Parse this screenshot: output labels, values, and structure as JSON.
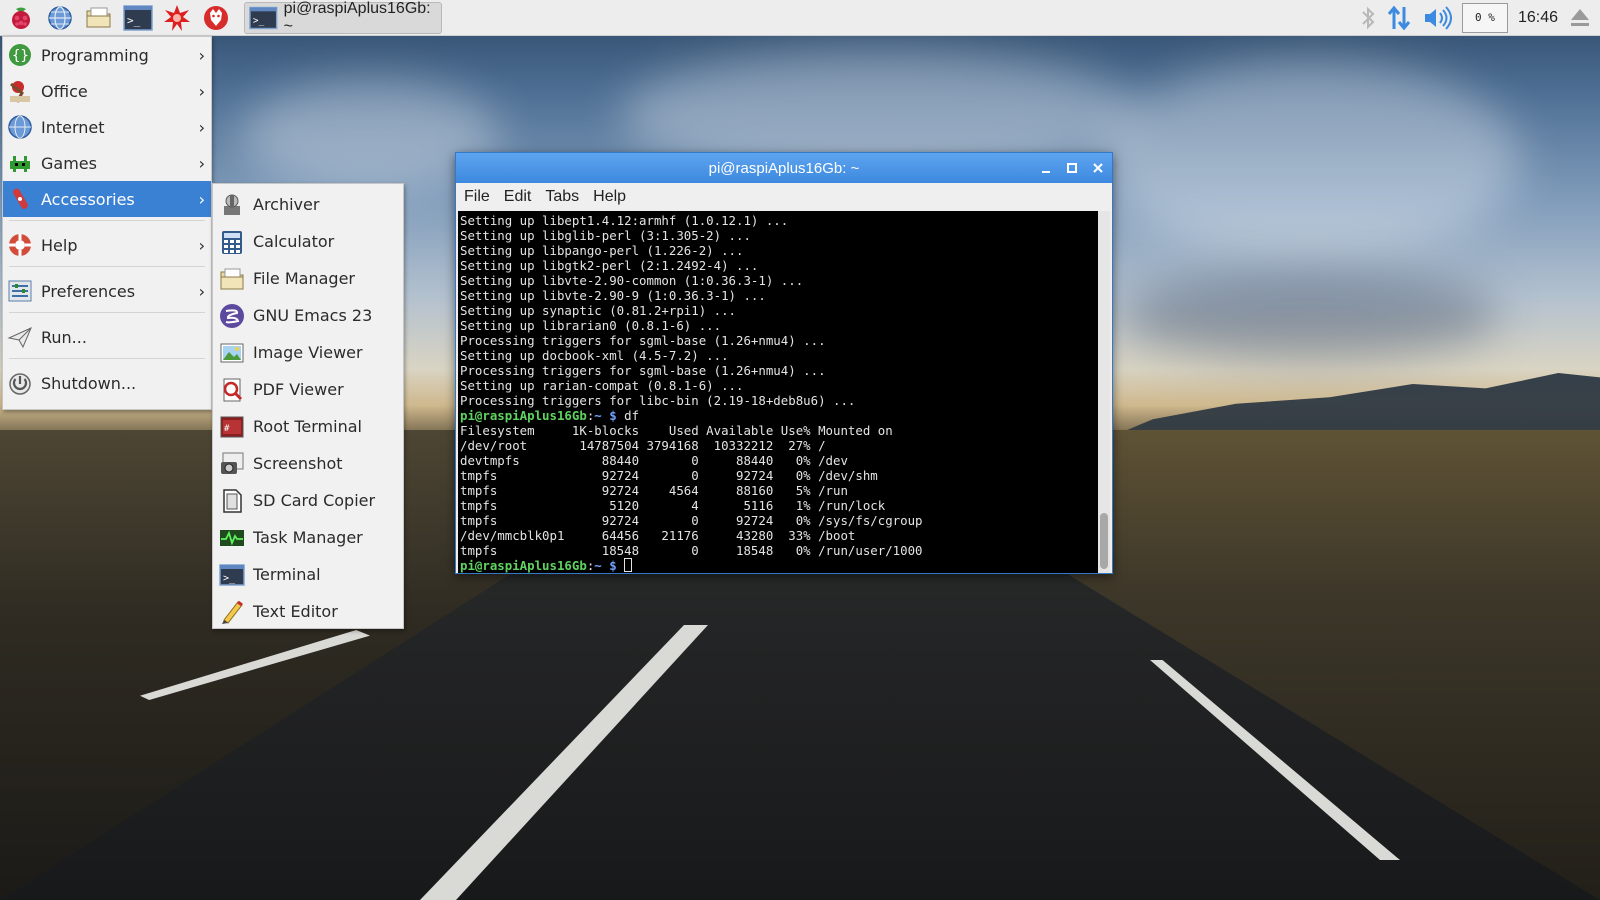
{
  "taskbar": {
    "launchers": [
      {
        "name": "raspberry-menu-icon"
      },
      {
        "name": "globe-browser-icon"
      },
      {
        "name": "file-manager-icon"
      },
      {
        "name": "terminal-icon"
      },
      {
        "name": "mathematica-icon"
      },
      {
        "name": "wolfram-icon"
      }
    ],
    "task_title": "pi@raspiAplus16Gb: ~",
    "cpu_label": "0 %",
    "clock": "16:46"
  },
  "menu": {
    "items": [
      {
        "label": "Programming",
        "icon": "programming-icon",
        "has_sub": true
      },
      {
        "label": "Office",
        "icon": "office-icon",
        "has_sub": true
      },
      {
        "label": "Internet",
        "icon": "internet-icon",
        "has_sub": true
      },
      {
        "label": "Games",
        "icon": "games-icon",
        "has_sub": true
      },
      {
        "label": "Accessories",
        "icon": "accessories-icon",
        "has_sub": true,
        "active": true
      },
      {
        "label": "Help",
        "icon": "help-icon",
        "has_sub": true
      },
      {
        "label": "Preferences",
        "icon": "preferences-icon",
        "has_sub": true
      },
      {
        "label": "Run...",
        "icon": "run-icon",
        "has_sub": false
      },
      {
        "label": "Shutdown...",
        "icon": "shutdown-icon",
        "has_sub": false
      }
    ],
    "arrow": "›"
  },
  "submenu": {
    "items": [
      {
        "label": "Archiver",
        "icon": "archiver-icon"
      },
      {
        "label": "Calculator",
        "icon": "calculator-icon"
      },
      {
        "label": "File Manager",
        "icon": "file-manager-icon"
      },
      {
        "label": "GNU Emacs 23",
        "icon": "emacs-icon"
      },
      {
        "label": "Image Viewer",
        "icon": "image-viewer-icon"
      },
      {
        "label": "PDF Viewer",
        "icon": "pdf-viewer-icon"
      },
      {
        "label": "Root Terminal",
        "icon": "root-terminal-icon"
      },
      {
        "label": "Screenshot",
        "icon": "screenshot-icon"
      },
      {
        "label": "SD Card Copier",
        "icon": "sd-card-icon"
      },
      {
        "label": "Task Manager",
        "icon": "task-manager-icon"
      },
      {
        "label": "Terminal",
        "icon": "terminal-icon"
      },
      {
        "label": "Text Editor",
        "icon": "text-editor-icon"
      }
    ]
  },
  "terminal": {
    "title": "pi@raspiAplus16Gb: ~",
    "menus": [
      "File",
      "Edit",
      "Tabs",
      "Help"
    ],
    "lines": [
      "Setting up libept1.4.12:armhf (1.0.12.1) ...",
      "Setting up libglib-perl (3:1.305-2) ...",
      "Setting up libpango-perl (1.226-2) ...",
      "Setting up libgtk2-perl (2:1.2492-4) ...",
      "Setting up libvte-2.90-common (1:0.36.3-1) ...",
      "Setting up libvte-2.90-9 (1:0.36.3-1) ...",
      "Setting up synaptic (0.81.2+rpi1) ...",
      "Setting up librarian0 (0.8.1-6) ...",
      "Processing triggers for sgml-base (1.26+nmu4) ...",
      "Setting up docbook-xml (4.5-7.2) ...",
      "Processing triggers for sgml-base (1.26+nmu4) ...",
      "Setting up rarian-compat (0.8.1-6) ...",
      "Processing triggers for libc-bin (2.19-18+deb8u6) ..."
    ],
    "prompt_user": "pi@raspiAplus16Gb",
    "prompt_path": "~",
    "prompt_symbol": "$",
    "command": "df",
    "df_output": [
      "Filesystem     1K-blocks    Used Available Use% Mounted on",
      "/dev/root       14787504 3794168  10332212  27% /",
      "devtmpfs           88440       0     88440   0% /dev",
      "tmpfs              92724       0     92724   0% /dev/shm",
      "tmpfs              92724    4564     88160   5% /run",
      "tmpfs               5120       4      5116   1% /run/lock",
      "tmpfs              92724       0     92724   0% /sys/fs/cgroup",
      "/dev/mmcblk0p1     64456   21176     43280  33% /boot",
      "tmpfs              18548       0     18548   0% /run/user/1000"
    ]
  }
}
